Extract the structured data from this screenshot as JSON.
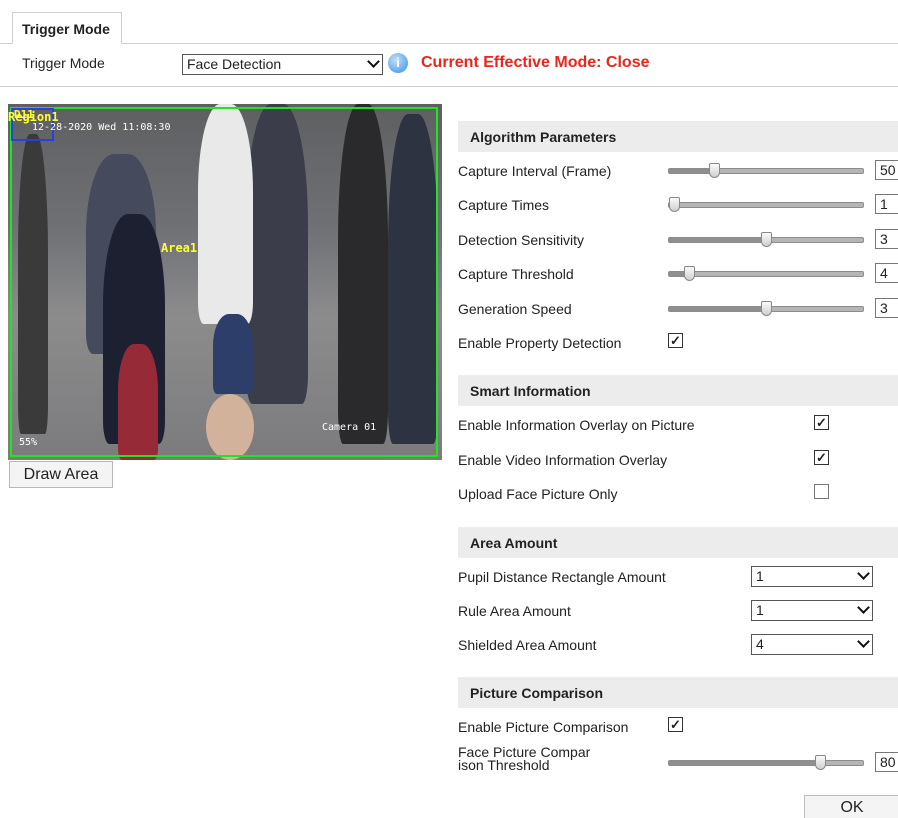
{
  "tab": {
    "label": "Trigger Mode"
  },
  "trigger": {
    "label": "Trigger Mode",
    "selected": "Face Detection",
    "effective_text": "Current Effective Mode:  Close"
  },
  "video": {
    "region_text": "Region1",
    "box_label": "D11",
    "timestamp": "12-28-2020 Wed 11:08:30",
    "area_label": "Area1",
    "camera_label": "Camera 01",
    "bitrate": "55%"
  },
  "draw_area_label": "Draw Area",
  "algorithm": {
    "title": "Algorithm Parameters",
    "rows": [
      {
        "label": "Capture Interval (Frame)",
        "value": "50",
        "level": 0.22
      },
      {
        "label": "Capture Times",
        "value": "1",
        "level": 0.0
      },
      {
        "label": "Detection Sensitivity",
        "value": "3",
        "level": 0.5
      },
      {
        "label": "Capture Threshold",
        "value": "4",
        "level": 0.08
      },
      {
        "label": "Generation Speed",
        "value": "3",
        "level": 0.5
      }
    ],
    "property_detection": {
      "label": "Enable Property Detection",
      "checked": true
    }
  },
  "smart": {
    "title": "Smart Information",
    "rows": [
      {
        "label": "Enable Information Overlay on Picture",
        "checked": true
      },
      {
        "label": "Enable Video Information Overlay",
        "checked": true
      },
      {
        "label": "Upload Face Picture Only",
        "checked": false
      }
    ]
  },
  "area": {
    "title": "Area Amount",
    "rows": [
      {
        "label": "Pupil Distance Rectangle Amount",
        "value": "1"
      },
      {
        "label": "Rule Area Amount",
        "value": "1"
      },
      {
        "label": "Shielded Area Amount",
        "value": "4"
      }
    ]
  },
  "comparison": {
    "title": "Picture Comparison",
    "enable": {
      "label": "Enable Picture Comparison",
      "checked": true
    },
    "threshold": {
      "label_line1": "Face Picture Compar",
      "label_line2": "ison Threshold",
      "value": "80",
      "level": 0.8
    }
  },
  "ok_label": "OK",
  "colors": {
    "effective_red": "#e8261c",
    "area_green": "#21e421",
    "osd_yellow": "#ffff30",
    "section_bg": "#ececec"
  },
  "icons": {
    "help": "help-icon",
    "dropdown": "chevron-down-icon",
    "check": "checkmark-icon"
  }
}
